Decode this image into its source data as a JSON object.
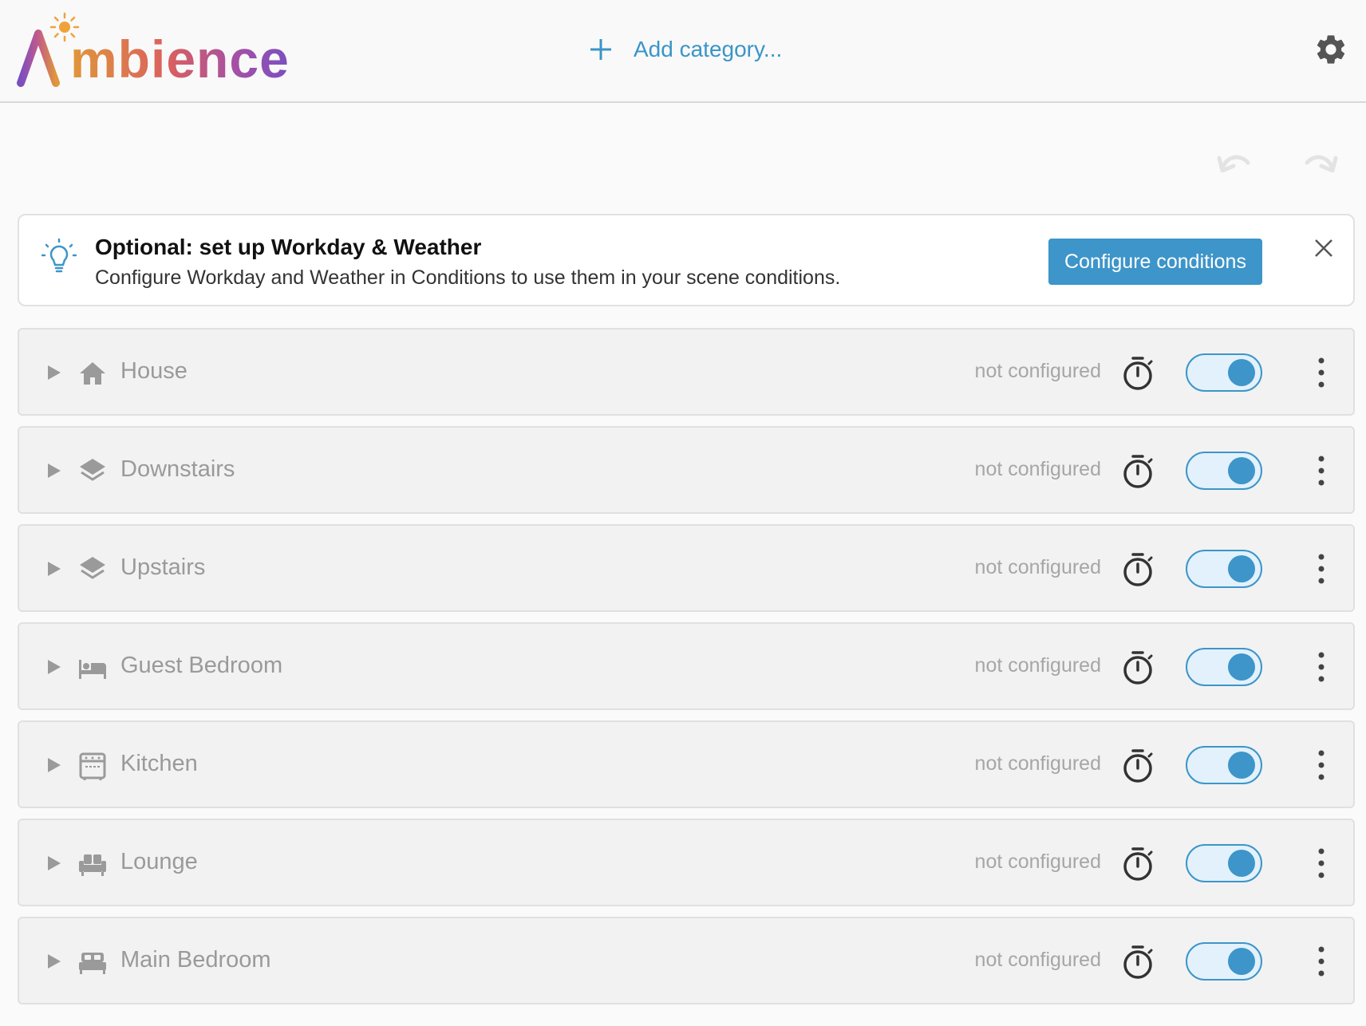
{
  "header": {
    "logo_text": "mbience",
    "logo_letter": "A",
    "add_category_label": "Add category...",
    "settings_icon": "gear-icon"
  },
  "toolbar": {
    "undo_icon": "undo-icon",
    "redo_icon": "redo-icon"
  },
  "banner": {
    "icon": "lightbulb-icon",
    "title": "Optional: set up Workday & Weather",
    "description": "Configure Workday and Weather in Conditions to use them in your scene conditions.",
    "button_label": "Configure conditions",
    "close_icon": "close-icon"
  },
  "categories": [
    {
      "name": "House",
      "icon": "home-icon",
      "status": "not configured",
      "enabled": true
    },
    {
      "name": "Downstairs",
      "icon": "layers-icon",
      "status": "not configured",
      "enabled": true
    },
    {
      "name": "Upstairs",
      "icon": "layers-icon",
      "status": "not configured",
      "enabled": true
    },
    {
      "name": "Guest Bedroom",
      "icon": "bed-icon",
      "status": "not configured",
      "enabled": true
    },
    {
      "name": "Kitchen",
      "icon": "stove-icon",
      "status": "not configured",
      "enabled": true
    },
    {
      "name": "Lounge",
      "icon": "sofa-icon",
      "status": "not configured",
      "enabled": true
    },
    {
      "name": "Main Bedroom",
      "icon": "double-bed-icon",
      "status": "not configured",
      "enabled": true
    }
  ],
  "colors": {
    "accent": "#3d95c9",
    "toggle_track": "#e2f1fb",
    "row_bg": "#f2f2f2",
    "muted_text": "#9a9a9a"
  }
}
